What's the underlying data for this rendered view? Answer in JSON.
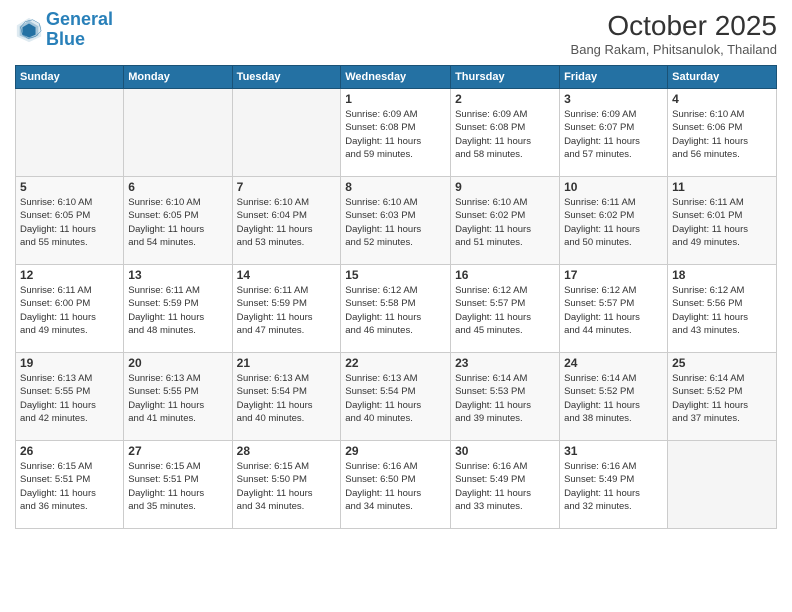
{
  "logo": {
    "line1": "General",
    "line2": "Blue"
  },
  "header": {
    "title": "October 2025",
    "subtitle": "Bang Rakam, Phitsanulok, Thailand"
  },
  "weekdays": [
    "Sunday",
    "Monday",
    "Tuesday",
    "Wednesday",
    "Thursday",
    "Friday",
    "Saturday"
  ],
  "weeks": [
    [
      {
        "day": "",
        "info": ""
      },
      {
        "day": "",
        "info": ""
      },
      {
        "day": "",
        "info": ""
      },
      {
        "day": "1",
        "info": "Sunrise: 6:09 AM\nSunset: 6:08 PM\nDaylight: 11 hours\nand 59 minutes."
      },
      {
        "day": "2",
        "info": "Sunrise: 6:09 AM\nSunset: 6:08 PM\nDaylight: 11 hours\nand 58 minutes."
      },
      {
        "day": "3",
        "info": "Sunrise: 6:09 AM\nSunset: 6:07 PM\nDaylight: 11 hours\nand 57 minutes."
      },
      {
        "day": "4",
        "info": "Sunrise: 6:10 AM\nSunset: 6:06 PM\nDaylight: 11 hours\nand 56 minutes."
      }
    ],
    [
      {
        "day": "5",
        "info": "Sunrise: 6:10 AM\nSunset: 6:05 PM\nDaylight: 11 hours\nand 55 minutes."
      },
      {
        "day": "6",
        "info": "Sunrise: 6:10 AM\nSunset: 6:05 PM\nDaylight: 11 hours\nand 54 minutes."
      },
      {
        "day": "7",
        "info": "Sunrise: 6:10 AM\nSunset: 6:04 PM\nDaylight: 11 hours\nand 53 minutes."
      },
      {
        "day": "8",
        "info": "Sunrise: 6:10 AM\nSunset: 6:03 PM\nDaylight: 11 hours\nand 52 minutes."
      },
      {
        "day": "9",
        "info": "Sunrise: 6:10 AM\nSunset: 6:02 PM\nDaylight: 11 hours\nand 51 minutes."
      },
      {
        "day": "10",
        "info": "Sunrise: 6:11 AM\nSunset: 6:02 PM\nDaylight: 11 hours\nand 50 minutes."
      },
      {
        "day": "11",
        "info": "Sunrise: 6:11 AM\nSunset: 6:01 PM\nDaylight: 11 hours\nand 49 minutes."
      }
    ],
    [
      {
        "day": "12",
        "info": "Sunrise: 6:11 AM\nSunset: 6:00 PM\nDaylight: 11 hours\nand 49 minutes."
      },
      {
        "day": "13",
        "info": "Sunrise: 6:11 AM\nSunset: 5:59 PM\nDaylight: 11 hours\nand 48 minutes."
      },
      {
        "day": "14",
        "info": "Sunrise: 6:11 AM\nSunset: 5:59 PM\nDaylight: 11 hours\nand 47 minutes."
      },
      {
        "day": "15",
        "info": "Sunrise: 6:12 AM\nSunset: 5:58 PM\nDaylight: 11 hours\nand 46 minutes."
      },
      {
        "day": "16",
        "info": "Sunrise: 6:12 AM\nSunset: 5:57 PM\nDaylight: 11 hours\nand 45 minutes."
      },
      {
        "day": "17",
        "info": "Sunrise: 6:12 AM\nSunset: 5:57 PM\nDaylight: 11 hours\nand 44 minutes."
      },
      {
        "day": "18",
        "info": "Sunrise: 6:12 AM\nSunset: 5:56 PM\nDaylight: 11 hours\nand 43 minutes."
      }
    ],
    [
      {
        "day": "19",
        "info": "Sunrise: 6:13 AM\nSunset: 5:55 PM\nDaylight: 11 hours\nand 42 minutes."
      },
      {
        "day": "20",
        "info": "Sunrise: 6:13 AM\nSunset: 5:55 PM\nDaylight: 11 hours\nand 41 minutes."
      },
      {
        "day": "21",
        "info": "Sunrise: 6:13 AM\nSunset: 5:54 PM\nDaylight: 11 hours\nand 40 minutes."
      },
      {
        "day": "22",
        "info": "Sunrise: 6:13 AM\nSunset: 5:54 PM\nDaylight: 11 hours\nand 40 minutes."
      },
      {
        "day": "23",
        "info": "Sunrise: 6:14 AM\nSunset: 5:53 PM\nDaylight: 11 hours\nand 39 minutes."
      },
      {
        "day": "24",
        "info": "Sunrise: 6:14 AM\nSunset: 5:52 PM\nDaylight: 11 hours\nand 38 minutes."
      },
      {
        "day": "25",
        "info": "Sunrise: 6:14 AM\nSunset: 5:52 PM\nDaylight: 11 hours\nand 37 minutes."
      }
    ],
    [
      {
        "day": "26",
        "info": "Sunrise: 6:15 AM\nSunset: 5:51 PM\nDaylight: 11 hours\nand 36 minutes."
      },
      {
        "day": "27",
        "info": "Sunrise: 6:15 AM\nSunset: 5:51 PM\nDaylight: 11 hours\nand 35 minutes."
      },
      {
        "day": "28",
        "info": "Sunrise: 6:15 AM\nSunset: 5:50 PM\nDaylight: 11 hours\nand 34 minutes."
      },
      {
        "day": "29",
        "info": "Sunrise: 6:16 AM\nSunset: 6:50 PM\nDaylight: 11 hours\nand 34 minutes."
      },
      {
        "day": "30",
        "info": "Sunrise: 6:16 AM\nSunset: 5:49 PM\nDaylight: 11 hours\nand 33 minutes."
      },
      {
        "day": "31",
        "info": "Sunrise: 6:16 AM\nSunset: 5:49 PM\nDaylight: 11 hours\nand 32 minutes."
      },
      {
        "day": "",
        "info": ""
      }
    ]
  ]
}
